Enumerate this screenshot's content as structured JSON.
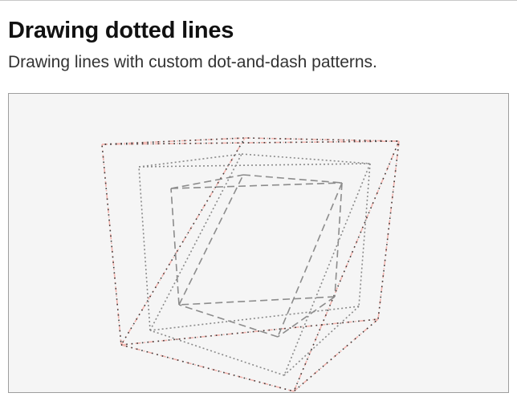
{
  "page": {
    "title": "Drawing dotted lines",
    "subtitle": "Drawing lines with custom dot-and-dash patterns."
  },
  "scene": {
    "background_color": "#f5f5f5",
    "outer_cube": {
      "line_styles": [
        "pink-dash-dot",
        "dark-dotted"
      ],
      "colors": {
        "pink": "#f4b6b0",
        "dark": "#3a3a3a"
      }
    },
    "middle_cube": {
      "line_style": "dotted",
      "color": "#8a8a8a"
    },
    "inner_cube": {
      "line_style": "dashed",
      "color": "#8c8c8c"
    }
  }
}
